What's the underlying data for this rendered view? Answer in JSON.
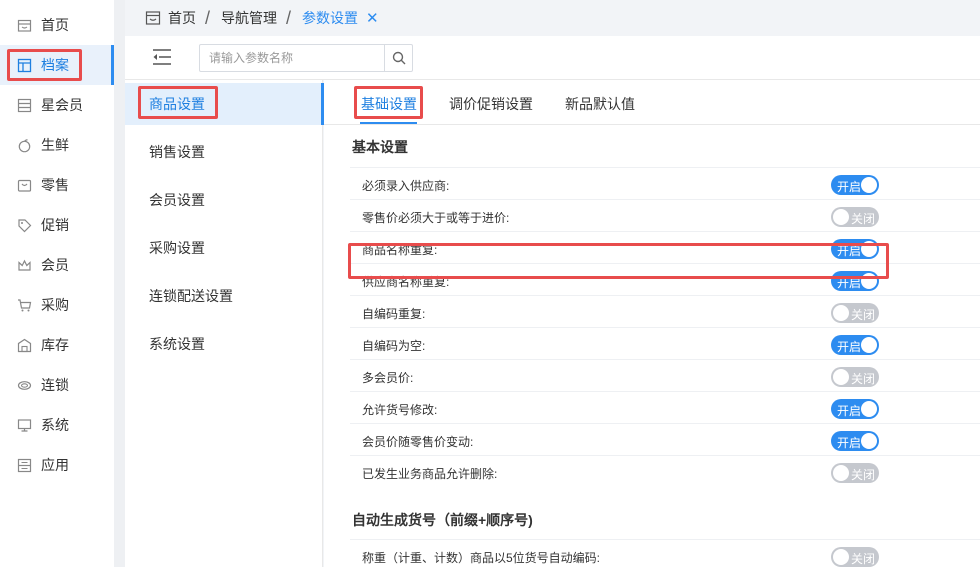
{
  "nav": {
    "items": [
      {
        "label": "首页",
        "icon": "home-icon"
      },
      {
        "label": "档案",
        "icon": "archive-icon"
      },
      {
        "label": "星会员",
        "icon": "star-member-icon"
      },
      {
        "label": "生鲜",
        "icon": "fresh-icon"
      },
      {
        "label": "零售",
        "icon": "retail-icon"
      },
      {
        "label": "促销",
        "icon": "tag-icon"
      },
      {
        "label": "会员",
        "icon": "crown-icon"
      },
      {
        "label": "采购",
        "icon": "cart-icon"
      },
      {
        "label": "库存",
        "icon": "warehouse-icon"
      },
      {
        "label": "连锁",
        "icon": "chain-icon"
      },
      {
        "label": "系统",
        "icon": "monitor-icon"
      },
      {
        "label": "应用",
        "icon": "apps-icon"
      }
    ],
    "active": "档案"
  },
  "breadcrumb": {
    "home": "首页",
    "parent": "导航管理",
    "current": "参数设置",
    "close": "✕"
  },
  "search": {
    "placeholder": "请输入参数名称"
  },
  "submenu": {
    "items": [
      "商品设置",
      "销售设置",
      "会员设置",
      "采购设置",
      "连锁配送设置",
      "系统设置"
    ],
    "active": "商品设置"
  },
  "tabs": {
    "items": [
      "基础设置",
      "调价促销设置",
      "新品默认值"
    ],
    "active": "基础设置"
  },
  "switch_text": {
    "on": "开启",
    "off": "关闭"
  },
  "sections": {
    "basic": {
      "title": "基本设置",
      "rows": [
        {
          "label": "必须录入供应商:",
          "on": true
        },
        {
          "label": "零售价必须大于或等于进价:",
          "on": false
        },
        {
          "label": "商品名称重复:",
          "on": true
        },
        {
          "label": "供应商名称重复:",
          "on": true
        },
        {
          "label": "自编码重复:",
          "on": false
        },
        {
          "label": "自编码为空:",
          "on": true
        },
        {
          "label": "多会员价:",
          "on": false
        },
        {
          "label": "允许货号修改:",
          "on": true
        },
        {
          "label": "会员价随零售价变动:",
          "on": true
        },
        {
          "label": "已发生业务商品允许删除:",
          "on": false
        }
      ]
    },
    "autocode": {
      "title": "自动生成货号（前缀+顺序号)",
      "rows": [
        {
          "label": "称重（计重、计数）商品以5位货号自动编码:",
          "on": false
        }
      ]
    }
  },
  "colors": {
    "accent": "#2d8cf0",
    "highlight": "#e84c4c",
    "switch_off": "#c5c8ce"
  }
}
